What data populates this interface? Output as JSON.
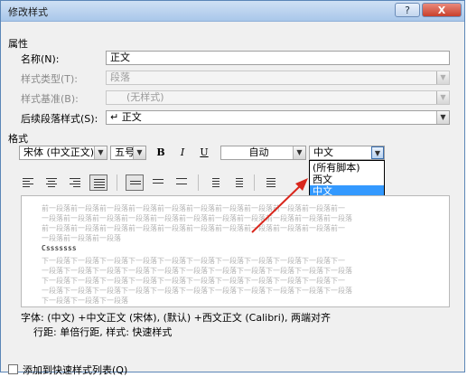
{
  "window": {
    "title": "修改样式",
    "help_label": "?",
    "close_label": "X"
  },
  "properties": {
    "section_label": "属性",
    "name_label": "名称(N):",
    "name_value": "正文",
    "style_type_label": "样式类型(T):",
    "style_type_value": "段落",
    "style_based_on_label": "样式基准(B):",
    "style_based_on_value": "(无样式)",
    "following_style_label": "后续段落样式(S):",
    "following_style_value": "正文",
    "following_style_icon": "paragraph-return-icon"
  },
  "format": {
    "section_label": "格式",
    "font_value": "宋体 (中文正文)",
    "size_value": "五号",
    "bold_label": "B",
    "italic_label": "I",
    "underline_label": "U",
    "color_value": "自动",
    "script_value": "中文",
    "script_options": [
      "(所有脚本)",
      "西文",
      "中文"
    ],
    "selected_option_index": 2,
    "selected_color": "#3399ff"
  },
  "preview": {
    "previous_lines": [
      "前一段落前一段落前一段落前一段落前一段落前一段落前一段落前一段落前一段落前一段落前一",
      "一段落前一段落前一段落前一段落前一段落前一段落前一段落前一段落前一段落前一段落前一段落",
      "前一段落前一段落前一段落前一段落前一段落前一段落前一段落前一段落前一段落前一段落前一",
      "一段落前一段落前一段落"
    ],
    "sample_text": "Csssssss",
    "next_lines": [
      "下一段落下一段落下一段落下一段落下一段落下一段落下一段落下一段落下一段落下一段落下一",
      "一段落下一段落下一段落下一段落下一段落下一段落下一段落下一段落下一段落下一段落下一段落",
      "下一段落下一段落下一段落下一段落下一段落下一段落下一段落下一段落下一段落下一段落下一",
      "一段落下一段落下一段落下一段落下一段落下一段落下一段落下一段落下一段落下一段落下一段落",
      "下一段落下一段落下一段落"
    ]
  },
  "description": {
    "line1": "字体: (中文) +中文正文 (宋体), (默认) +西文正文 (Calibri), 两端对齐",
    "line2": "行距: 单倍行距, 样式: 快速样式"
  },
  "bottom": {
    "add_to_quick_styles_label": "添加到快速样式列表(Q)"
  },
  "colors": {
    "annotation_arrow": "#d9261c",
    "titlebar_top": "#cfe0f4",
    "titlebar_bottom": "#a9c7ea"
  }
}
